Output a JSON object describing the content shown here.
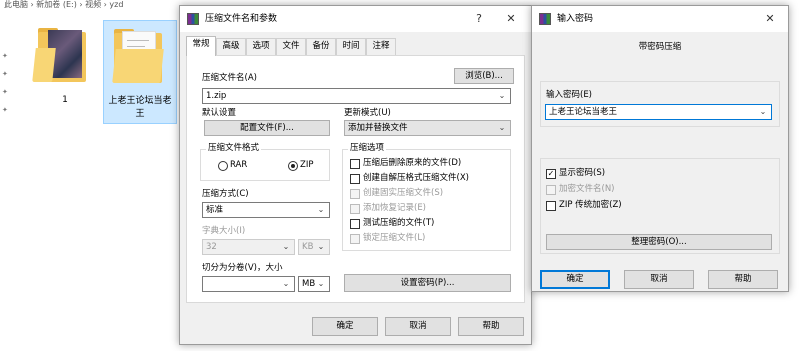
{
  "explorer": {
    "breadcrumb": "此电脑 › 新加卷 (E:) › 视频 › yzd",
    "files": [
      {
        "name": "1"
      },
      {
        "name": "上老王论坛当老王"
      }
    ]
  },
  "archive_dialog": {
    "title": "压缩文件名和参数",
    "help_glyph": "?",
    "close_glyph": "✕",
    "tabs": [
      "常规",
      "高级",
      "选项",
      "文件",
      "备份",
      "时间",
      "注释"
    ],
    "archive_name_label": "压缩文件名(A)",
    "browse_button": "浏览(B)...",
    "archive_name_value": "1.zip",
    "default_settings_label": "默认设置",
    "profiles_button": "配置文件(F)...",
    "update_mode_label": "更新模式(U)",
    "update_mode_value": "添加并替换文件",
    "format_group_label": "压缩文件格式",
    "format_rar": "RAR",
    "format_zip": "ZIP",
    "selected_format": "ZIP",
    "method_label": "压缩方式(C)",
    "method_value": "标准",
    "dict_label": "字典大小(I)",
    "dict_value": "32",
    "dict_unit": "KB",
    "split_label": "切分为分卷(V)，大小",
    "split_value": "",
    "split_unit": "MB",
    "set_password_button": "设置密码(P)...",
    "options_group_label": "压缩选项",
    "options": [
      {
        "label": "压缩后删除原来的文件(D)",
        "checked": false,
        "enabled": true
      },
      {
        "label": "创建自解压格式压缩文件(X)",
        "checked": false,
        "enabled": true
      },
      {
        "label": "创建固实压缩文件(S)",
        "checked": false,
        "enabled": false
      },
      {
        "label": "添加恢复记录(E)",
        "checked": false,
        "enabled": false
      },
      {
        "label": "测试压缩的文件(T)",
        "checked": false,
        "enabled": true
      },
      {
        "label": "锁定压缩文件(L)",
        "checked": false,
        "enabled": false
      }
    ],
    "ok_button": "确定",
    "cancel_button": "取消",
    "help_button": "帮助"
  },
  "password_dialog": {
    "title": "输入密码",
    "close_glyph": "✕",
    "heading": "带密码压缩",
    "password_label": "输入密码(E)",
    "password_value": "上老王论坛当老王",
    "options": [
      {
        "label": "显示密码(S)",
        "checked": true,
        "enabled": true
      },
      {
        "label": "加密文件名(N)",
        "checked": false,
        "enabled": false
      },
      {
        "label": "ZIP 传统加密(Z)",
        "checked": false,
        "enabled": true
      }
    ],
    "organize_button": "整理密码(O)...",
    "ok_button": "确定",
    "cancel_button": "取消",
    "help_button": "帮助"
  }
}
